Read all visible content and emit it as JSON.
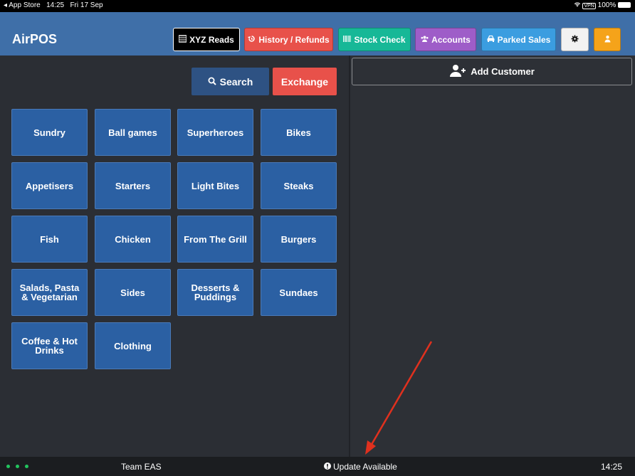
{
  "status_bar": {
    "back_label": "◂ App Store",
    "time": "14:25",
    "date": "Fri 17 Sep",
    "vpn": "VPN",
    "battery": "100%"
  },
  "header": {
    "title": "AirPOS",
    "buttons": {
      "xyz_reads": "XYZ Reads",
      "history": "History / Refunds",
      "stock_check": "Stock Check",
      "accounts": "Accounts",
      "parked_sales": "Parked Sales"
    },
    "colors": {
      "header_bg": "#3f6fa8",
      "xyz": "#000000",
      "history": "#e8514a",
      "stock": "#17b897",
      "accounts": "#9e5dc8",
      "parked": "#3b9de0",
      "settings": "#f2f2f2",
      "user": "#f5a31a"
    }
  },
  "actions": {
    "search": "Search",
    "exchange": "Exchange",
    "add_customer": "Add Customer"
  },
  "categories": [
    "Sundry",
    "Ball games",
    "Superheroes",
    "Bikes",
    "Appetisers",
    "Starters",
    "Light Bites",
    "Steaks",
    "Fish",
    "Chicken",
    "From The Grill",
    "Burgers",
    "Salads, Pasta & Vegetarian",
    "Sides",
    "Desserts & Puddings",
    "Sundaes",
    "Coffee & Hot Drinks",
    "Clothing"
  ],
  "footer": {
    "team": "Team EAS",
    "update": "Update Available",
    "time": "14:25"
  },
  "icons": [
    "wifi-icon",
    "battery-icon",
    "list-icon",
    "history-icon",
    "barcode-icon",
    "users-icon",
    "car-icon",
    "gear-icon",
    "user-icon",
    "search-icon",
    "user-plus-icon",
    "info-icon"
  ]
}
